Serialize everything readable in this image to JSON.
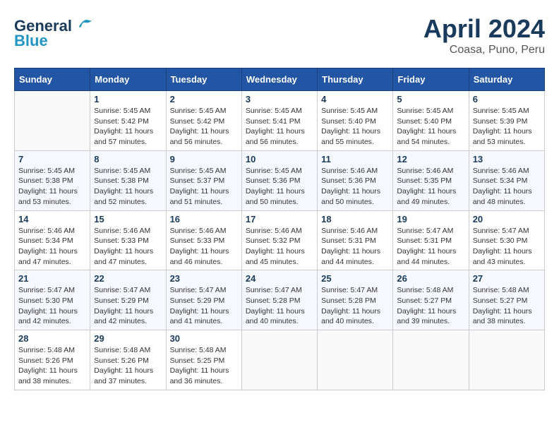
{
  "header": {
    "logo_line1": "General",
    "logo_line2": "Blue",
    "month_title": "April 2024",
    "location": "Coasa, Puno, Peru"
  },
  "days_of_week": [
    "Sunday",
    "Monday",
    "Tuesday",
    "Wednesday",
    "Thursday",
    "Friday",
    "Saturday"
  ],
  "weeks": [
    [
      {
        "day": "",
        "info": ""
      },
      {
        "day": "1",
        "info": "Sunrise: 5:45 AM\nSunset: 5:42 PM\nDaylight: 11 hours\nand 57 minutes."
      },
      {
        "day": "2",
        "info": "Sunrise: 5:45 AM\nSunset: 5:42 PM\nDaylight: 11 hours\nand 56 minutes."
      },
      {
        "day": "3",
        "info": "Sunrise: 5:45 AM\nSunset: 5:41 PM\nDaylight: 11 hours\nand 56 minutes."
      },
      {
        "day": "4",
        "info": "Sunrise: 5:45 AM\nSunset: 5:40 PM\nDaylight: 11 hours\nand 55 minutes."
      },
      {
        "day": "5",
        "info": "Sunrise: 5:45 AM\nSunset: 5:40 PM\nDaylight: 11 hours\nand 54 minutes."
      },
      {
        "day": "6",
        "info": "Sunrise: 5:45 AM\nSunset: 5:39 PM\nDaylight: 11 hours\nand 53 minutes."
      }
    ],
    [
      {
        "day": "7",
        "info": "Sunrise: 5:45 AM\nSunset: 5:38 PM\nDaylight: 11 hours\nand 53 minutes."
      },
      {
        "day": "8",
        "info": "Sunrise: 5:45 AM\nSunset: 5:38 PM\nDaylight: 11 hours\nand 52 minutes."
      },
      {
        "day": "9",
        "info": "Sunrise: 5:45 AM\nSunset: 5:37 PM\nDaylight: 11 hours\nand 51 minutes."
      },
      {
        "day": "10",
        "info": "Sunrise: 5:45 AM\nSunset: 5:36 PM\nDaylight: 11 hours\nand 50 minutes."
      },
      {
        "day": "11",
        "info": "Sunrise: 5:46 AM\nSunset: 5:36 PM\nDaylight: 11 hours\nand 50 minutes."
      },
      {
        "day": "12",
        "info": "Sunrise: 5:46 AM\nSunset: 5:35 PM\nDaylight: 11 hours\nand 49 minutes."
      },
      {
        "day": "13",
        "info": "Sunrise: 5:46 AM\nSunset: 5:34 PM\nDaylight: 11 hours\nand 48 minutes."
      }
    ],
    [
      {
        "day": "14",
        "info": "Sunrise: 5:46 AM\nSunset: 5:34 PM\nDaylight: 11 hours\nand 47 minutes."
      },
      {
        "day": "15",
        "info": "Sunrise: 5:46 AM\nSunset: 5:33 PM\nDaylight: 11 hours\nand 47 minutes."
      },
      {
        "day": "16",
        "info": "Sunrise: 5:46 AM\nSunset: 5:33 PM\nDaylight: 11 hours\nand 46 minutes."
      },
      {
        "day": "17",
        "info": "Sunrise: 5:46 AM\nSunset: 5:32 PM\nDaylight: 11 hours\nand 45 minutes."
      },
      {
        "day": "18",
        "info": "Sunrise: 5:46 AM\nSunset: 5:31 PM\nDaylight: 11 hours\nand 44 minutes."
      },
      {
        "day": "19",
        "info": "Sunrise: 5:47 AM\nSunset: 5:31 PM\nDaylight: 11 hours\nand 44 minutes."
      },
      {
        "day": "20",
        "info": "Sunrise: 5:47 AM\nSunset: 5:30 PM\nDaylight: 11 hours\nand 43 minutes."
      }
    ],
    [
      {
        "day": "21",
        "info": "Sunrise: 5:47 AM\nSunset: 5:30 PM\nDaylight: 11 hours\nand 42 minutes."
      },
      {
        "day": "22",
        "info": "Sunrise: 5:47 AM\nSunset: 5:29 PM\nDaylight: 11 hours\nand 42 minutes."
      },
      {
        "day": "23",
        "info": "Sunrise: 5:47 AM\nSunset: 5:29 PM\nDaylight: 11 hours\nand 41 minutes."
      },
      {
        "day": "24",
        "info": "Sunrise: 5:47 AM\nSunset: 5:28 PM\nDaylight: 11 hours\nand 40 minutes."
      },
      {
        "day": "25",
        "info": "Sunrise: 5:47 AM\nSunset: 5:28 PM\nDaylight: 11 hours\nand 40 minutes."
      },
      {
        "day": "26",
        "info": "Sunrise: 5:48 AM\nSunset: 5:27 PM\nDaylight: 11 hours\nand 39 minutes."
      },
      {
        "day": "27",
        "info": "Sunrise: 5:48 AM\nSunset: 5:27 PM\nDaylight: 11 hours\nand 38 minutes."
      }
    ],
    [
      {
        "day": "28",
        "info": "Sunrise: 5:48 AM\nSunset: 5:26 PM\nDaylight: 11 hours\nand 38 minutes."
      },
      {
        "day": "29",
        "info": "Sunrise: 5:48 AM\nSunset: 5:26 PM\nDaylight: 11 hours\nand 37 minutes."
      },
      {
        "day": "30",
        "info": "Sunrise: 5:48 AM\nSunset: 5:25 PM\nDaylight: 11 hours\nand 36 minutes."
      },
      {
        "day": "",
        "info": ""
      },
      {
        "day": "",
        "info": ""
      },
      {
        "day": "",
        "info": ""
      },
      {
        "day": "",
        "info": ""
      }
    ]
  ]
}
